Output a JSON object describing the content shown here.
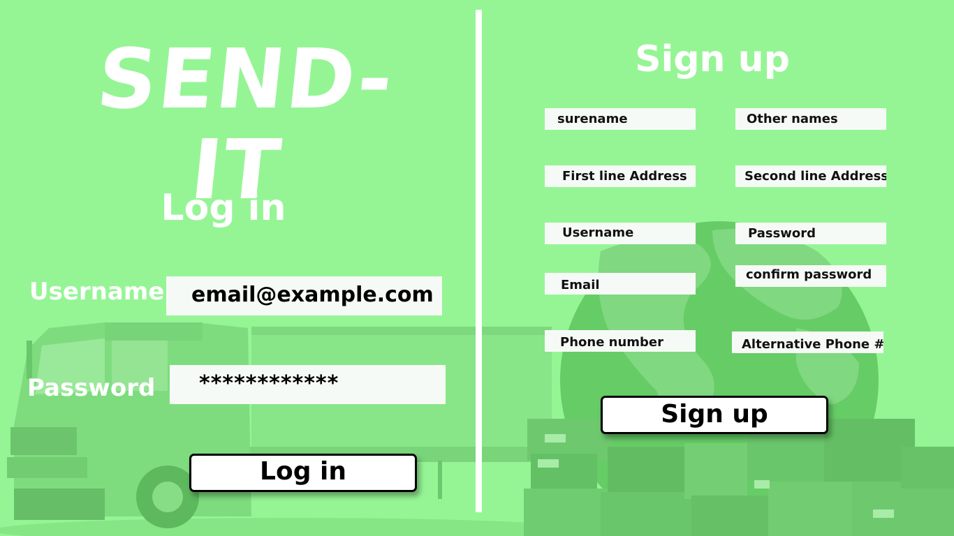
{
  "app": {
    "logo_text": "SEND-IT"
  },
  "login": {
    "title": "Log in",
    "username_label": "Username",
    "username_value": "email@example.com",
    "password_label": "Password",
    "password_value": "************",
    "submit_label": "Log in"
  },
  "signup": {
    "title": "Sign up",
    "fields": {
      "surname": "surename",
      "other_names": "Other names",
      "address_line1": "First line Address",
      "address_line2": "Second line Address",
      "username": "Username",
      "password": "Password",
      "email": "Email",
      "confirm_password": "confirm password",
      "phone": "Phone number",
      "alt_phone": "Alternative Phone #"
    },
    "submit_label": "Sign up"
  },
  "colors": {
    "background": "#95f595",
    "truck": "#74d374",
    "globe": "#5cc25c",
    "boxes": "#66c466"
  },
  "background_illustration": [
    "truck-illustration",
    "globe-illustration",
    "parcel-boxes-illustration"
  ]
}
